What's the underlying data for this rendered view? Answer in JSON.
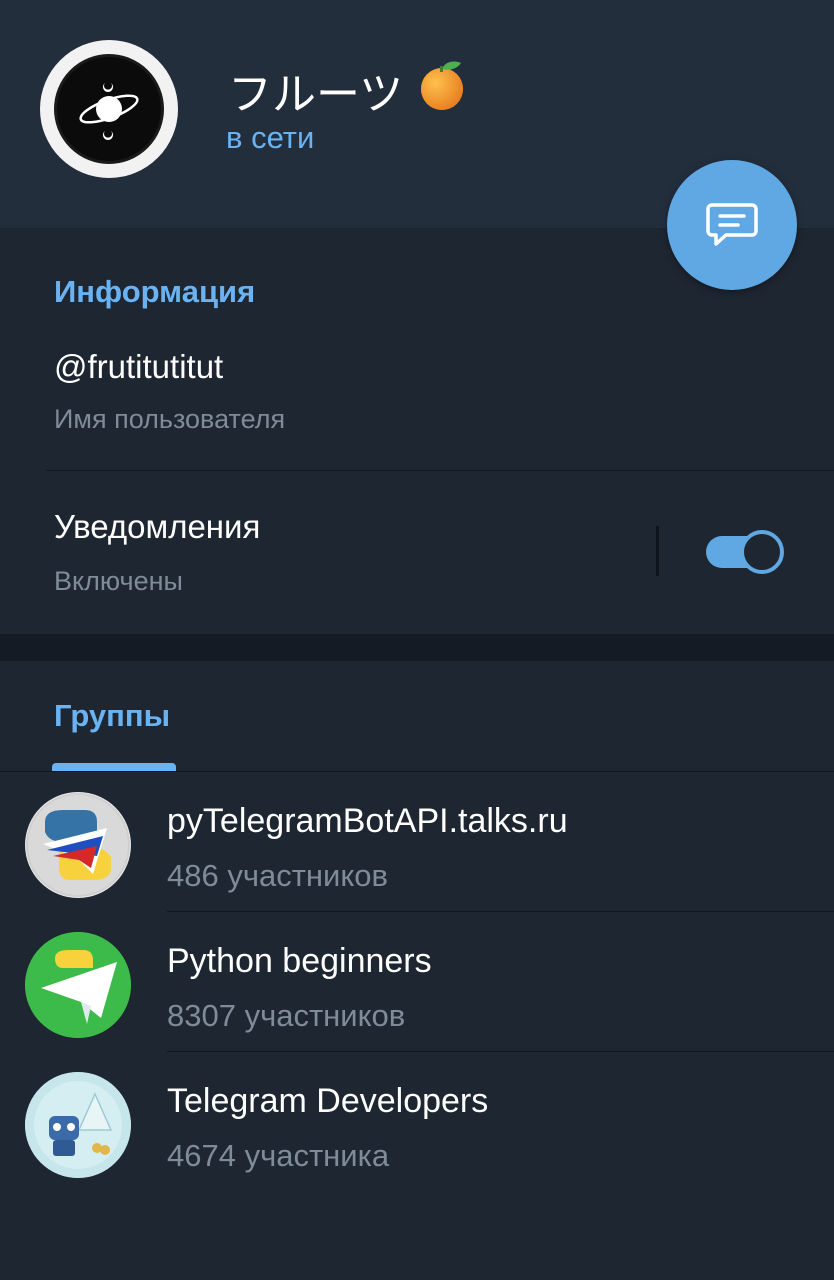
{
  "profile": {
    "name": "フルーツ",
    "name_emoji": "tangerine-emoji",
    "status": "в сети"
  },
  "info": {
    "section_title": "Информация",
    "username": "@frutitutitut",
    "username_label": "Имя пользователя",
    "notifications_title": "Уведомления",
    "notifications_status": "Включены",
    "notifications_enabled": true
  },
  "groups": {
    "section_title": "Группы",
    "items": [
      {
        "name": "pyTelegramBotAPI.talks.ru",
        "members": "486 участников",
        "icon": "python-telegram-russia-avatar"
      },
      {
        "name": "Python beginners",
        "members": "8307 участников",
        "icon": "python-telegram-green-avatar"
      },
      {
        "name": "Telegram Developers",
        "members": "4674 участника",
        "icon": "robot-tree-avatar"
      }
    ]
  },
  "colors": {
    "accent": "#6ab3f3",
    "fab": "#5fa8e3",
    "background": "#1e2632",
    "header": "#232e3d",
    "secondary_text": "#7f8b98"
  }
}
